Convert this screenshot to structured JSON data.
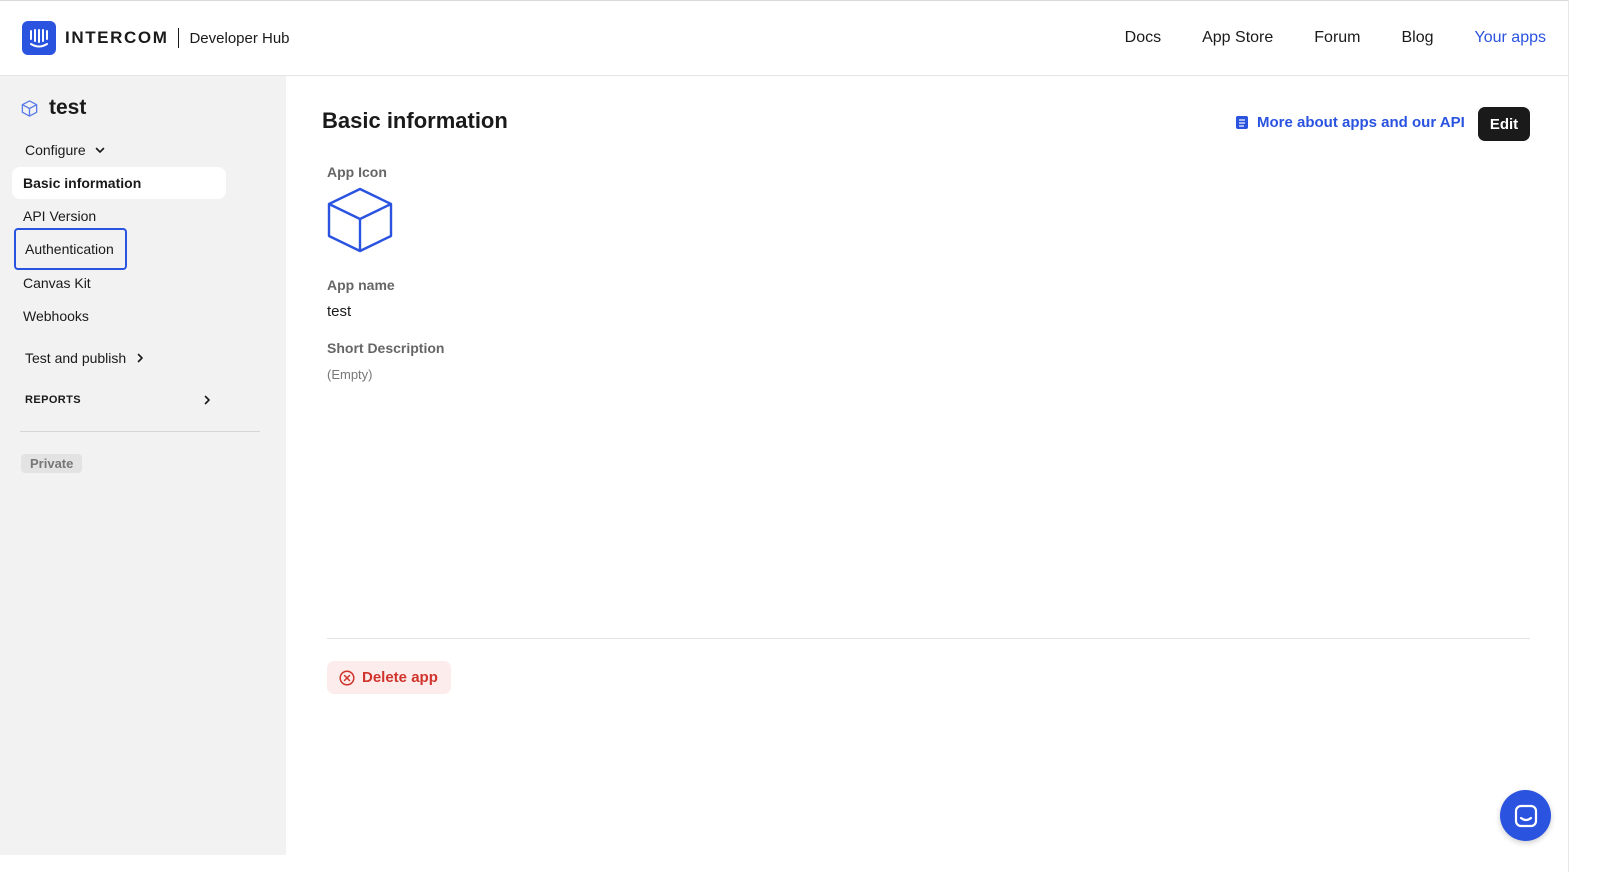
{
  "header": {
    "brand_name": "INTERCOM",
    "brand_sub": "Developer Hub",
    "nav": [
      {
        "label": "Docs"
      },
      {
        "label": "App Store"
      },
      {
        "label": "Forum"
      },
      {
        "label": "Blog"
      },
      {
        "label": "Your apps"
      }
    ]
  },
  "sidebar": {
    "app_title": "test",
    "configure_label": "Configure",
    "items": [
      {
        "label": "Basic information"
      },
      {
        "label": "API Version"
      },
      {
        "label": "Authentication"
      },
      {
        "label": "Canvas Kit"
      },
      {
        "label": "Webhooks"
      }
    ],
    "test_publish_label": "Test and publish",
    "reports_label": "REPORTS",
    "status_badge": "Private"
  },
  "main": {
    "title": "Basic information",
    "more_link": "More about apps and our API",
    "edit_label": "Edit",
    "app_icon_label": "App Icon",
    "app_name_label": "App name",
    "app_name_value": "test",
    "short_desc_label": "Short Description",
    "short_desc_value": "(Empty)",
    "delete_label": "Delete app"
  },
  "colors": {
    "accent": "#2a53e0",
    "danger": "#d0342c",
    "sidebar_bg": "#f2f2f2"
  },
  "icons": [
    "intercom-logo-icon",
    "cube-icon",
    "chevron-down-icon",
    "chevron-right-icon",
    "book-icon",
    "close-circle-icon",
    "messenger-icon"
  ]
}
